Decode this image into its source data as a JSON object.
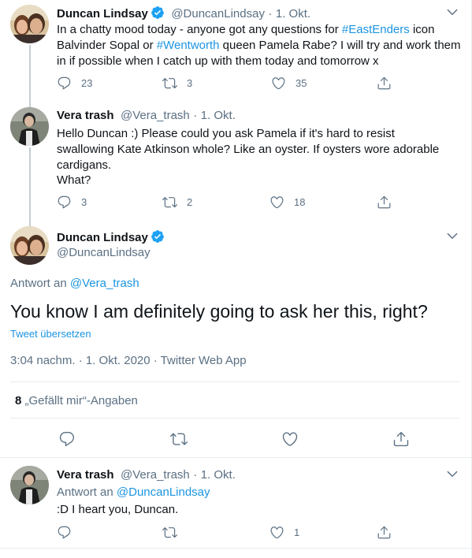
{
  "tweets": [
    {
      "name": "Duncan Lindsay",
      "handle": "@DuncanLindsay",
      "date": "1. Okt.",
      "text_parts": [
        "In a chatty mood today - anyone got any questions for ",
        "#EastEnders",
        " icon Balvinder Sopal or ",
        "#Wentworth",
        " queen Pamela Rabe? I will try and work them in if possible when I catch up with them today and tomorrow x"
      ],
      "replies": "23",
      "retweets": "3",
      "likes": "35"
    },
    {
      "name": "Vera trash",
      "handle": "@Vera_trash",
      "date": "1. Okt.",
      "text": "Hello Duncan :) Please could you ask Pamela if it's hard to resist swallowing Kate Atkinson whole? Like an oyster. If oysters wore adorable cardigans.",
      "text2": "What?",
      "replies": "3",
      "retweets": "2",
      "likes": "18"
    }
  ],
  "main": {
    "name": "Duncan Lindsay",
    "handle": "@DuncanLindsay",
    "reply_to_label": "Antwort an",
    "reply_to_handle": "@Vera_trash",
    "text": "You know I am definitely going to ask her this, right?",
    "translate": "Tweet übersetzen",
    "meta": "3:04 nachm. · 1. Okt. 2020 · Twitter Web App",
    "likes_count": "8",
    "likes_label": "„Gefällt mir“-Angaben"
  },
  "reply": {
    "name": "Vera trash",
    "handle": "@Vera_trash",
    "date": "1. Okt.",
    "reply_to_label": "Antwort an",
    "reply_to_handle": "@DuncanLindsay",
    "text": ":D I heart you, Duncan.",
    "likes": "1"
  },
  "separator": "·",
  "colors": {
    "accent": "#1b95e0",
    "muted": "#5b7083",
    "border": "#e6ecf0",
    "verified": "#1da1f2"
  }
}
